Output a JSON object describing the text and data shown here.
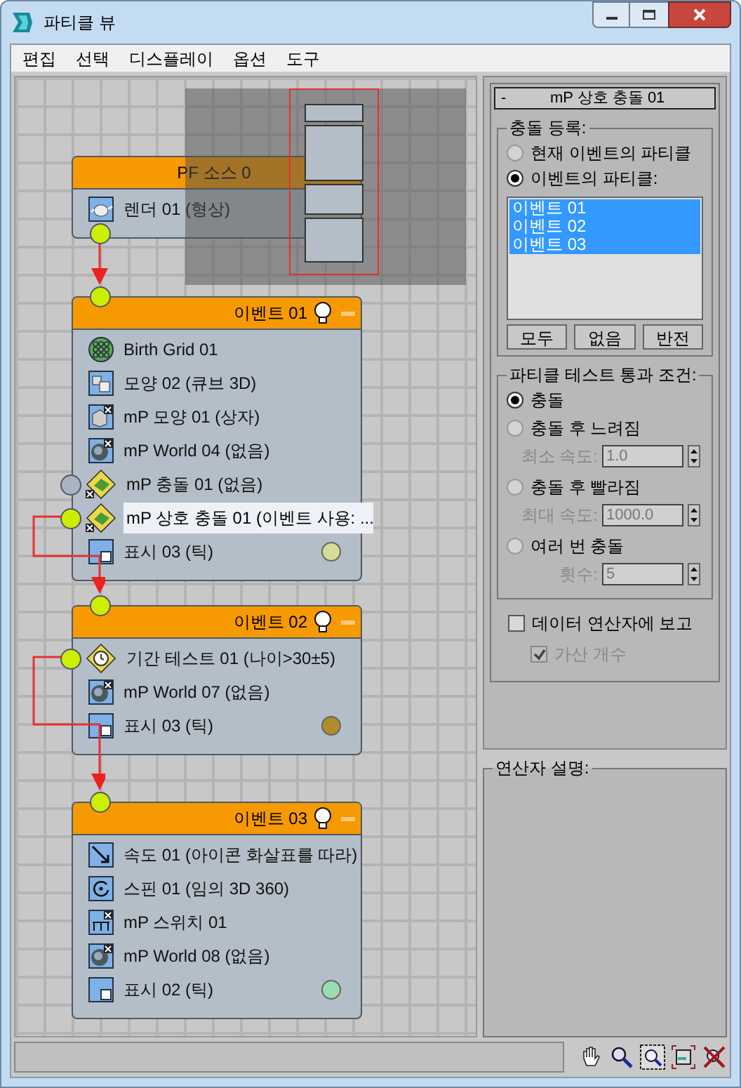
{
  "window": {
    "title": "파티클 뷰"
  },
  "menu": [
    "편집",
    "선택",
    "디스플레이",
    "옵션",
    "도구"
  ],
  "nodes": [
    {
      "kind": "source",
      "title": "PF 소스 0",
      "operators": [
        {
          "kind": "teapot",
          "label": "렌더 01 (형상)",
          "selected": false
        }
      ]
    },
    {
      "kind": "event",
      "title": "이벤트 01",
      "operators": [
        {
          "kind": "grid",
          "label": "Birth Grid 01",
          "selected": false
        },
        {
          "kind": "shape",
          "label": "모양 02 (큐브 3D)",
          "selected": false
        },
        {
          "kind": "mpshape",
          "label": "mP 모양 01 (상자)",
          "selected": false
        },
        {
          "kind": "world",
          "label": "mP World 04 (없음)",
          "selected": false
        },
        {
          "kind": "collision",
          "label": "mP 충돌 01 (없음)",
          "selected": false,
          "connected": false
        },
        {
          "kind": "collision",
          "label": "mP 상호 충돌 01 (이벤트 사용: ...",
          "selected": true,
          "connected": true
        },
        {
          "kind": "display",
          "label": "표시 03 (틱)",
          "selected": false,
          "color": "#d4dc98"
        }
      ]
    },
    {
      "kind": "event",
      "title": "이벤트 02",
      "operators": [
        {
          "kind": "age",
          "label": "기간 테스트 01 (나이>30±5)",
          "selected": false,
          "connected": true
        },
        {
          "kind": "world",
          "label": "mP World 07 (없음)",
          "selected": false
        },
        {
          "kind": "display",
          "label": "표시 03 (틱)",
          "selected": false,
          "color": "#b08c28"
        }
      ]
    },
    {
      "kind": "event",
      "title": "이벤트 03",
      "operators": [
        {
          "kind": "speed",
          "label": "속도 01 (아이콘 화살표를 따라)",
          "selected": false
        },
        {
          "kind": "spin",
          "label": "스핀 01 (임의 3D 360)",
          "selected": false
        },
        {
          "kind": "switch",
          "label": "mP 스위치  01",
          "selected": false
        },
        {
          "kind": "world",
          "label": "mP World 08 (없음)",
          "selected": false
        },
        {
          "kind": "display",
          "label": "표시 02 (틱)",
          "selected": false,
          "color": "#98dcb0"
        }
      ]
    }
  ],
  "rollout": {
    "collapse": "-",
    "title": "mP 상호 충돌 01",
    "registration": {
      "label": "충돌 등록:",
      "options": [
        {
          "label": "현재 이벤트의 파티클",
          "selected": false
        },
        {
          "label": "이벤트의 파티클:",
          "selected": true
        }
      ],
      "events": [
        {
          "label": "이벤트 01",
          "selected": true
        },
        {
          "label": "이벤트 02",
          "selected": true
        },
        {
          "label": "이벤트 03",
          "selected": true
        }
      ],
      "buttons": [
        "모두",
        "없음",
        "반전"
      ]
    },
    "condition": {
      "label": "파티클 테스트 통과 조건:",
      "options": [
        {
          "label": "충돌",
          "selected": true
        },
        {
          "label": "충돌 후 느려짐",
          "selected": false,
          "field": {
            "label": "최소 속도:",
            "value": "1.0"
          }
        },
        {
          "label": "충돌 후 빨라짐",
          "selected": false,
          "field": {
            "label": "최대 속도:",
            "value": "1000.0"
          }
        },
        {
          "label": "여러 번 충돌",
          "selected": false,
          "field": {
            "label": "횟수:",
            "value": "5"
          }
        }
      ]
    },
    "report": {
      "label": "데이터 연산자에 보고",
      "checked": false
    },
    "additive": {
      "label": "가산 개수",
      "checked": true,
      "disabled": true
    }
  },
  "description": {
    "label": "연산자 설명:"
  }
}
